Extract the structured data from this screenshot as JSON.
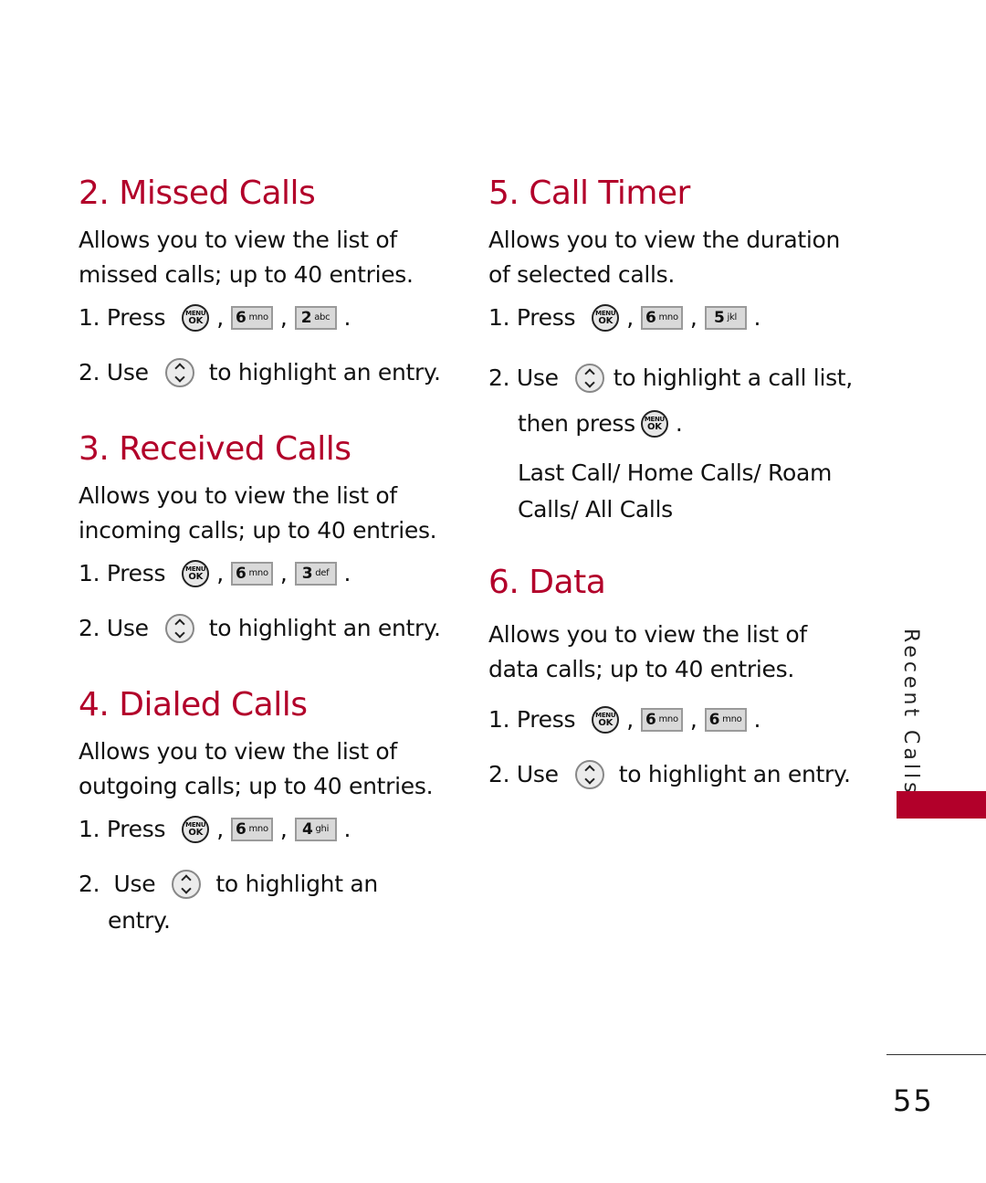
{
  "sections": {
    "missed": {
      "title": "2. Missed Calls",
      "desc_line1": "Allows you to view the list of",
      "desc_line2": "missed calls; up to 40 entries.",
      "step1_num": "1. Press",
      "step1_keys": [
        {
          "digit": "6",
          "letters": "mno"
        },
        {
          "digit": "2",
          "letters": "abc"
        }
      ],
      "step2_num": "2. Use",
      "step2_text": "to highlight an entry."
    },
    "received": {
      "title": "3. Received Calls",
      "desc_line1": "Allows you to view the list of",
      "desc_line2": "incoming calls; up to 40 entries.",
      "step1_num": "1. Press",
      "step1_keys": [
        {
          "digit": "6",
          "letters": "mno"
        },
        {
          "digit": "3",
          "letters": "def"
        }
      ],
      "step2_num": "2. Use",
      "step2_text": "to highlight an entry."
    },
    "dialed": {
      "title": "4. Dialed Calls",
      "desc_line1": "Allows you to view the list of",
      "desc_line2": "outgoing calls; up to 40 entries.",
      "step1_num": "1. Press",
      "step1_keys": [
        {
          "digit": "6",
          "letters": "mno"
        },
        {
          "digit": "4",
          "letters": "ghi"
        }
      ],
      "step2_num": "2.  Use",
      "step2_text": "to highlight an",
      "step2_cont": "entry."
    },
    "timer": {
      "title": "5. Call Timer",
      "desc_line1": "Allows you to view the duration",
      "desc_line2": "of selected calls.",
      "step1_num": "1. Press",
      "step1_keys": [
        {
          "digit": "6",
          "letters": "mno"
        },
        {
          "digit": "5",
          "letters": "jkl"
        }
      ],
      "step2_num": "2. Use",
      "step2_text": "to highlight a call list,",
      "step2_cont": "then press",
      "submenu_line1": "Last Call/ Home Calls/ Roam",
      "submenu_line2": "Calls/ All Calls"
    },
    "data": {
      "title": "6. Data",
      "desc_line1": "Allows you to view the list of",
      "desc_line2": "data calls; up to 40 entries.",
      "step1_num": "1. Press",
      "step1_keys": [
        {
          "digit": "6",
          "letters": "mno"
        },
        {
          "digit": "6",
          "letters": "mno"
        }
      ],
      "step2_num": "2. Use",
      "step2_text": "to highlight an entry."
    }
  },
  "icons": {
    "menu_top": "MENU",
    "menu_bottom": "OK",
    "comma": ",",
    "period": "."
  },
  "sidebar": {
    "label": "Recent Calls",
    "accent_color": "#b2002a"
  },
  "footer": {
    "page_number": "55"
  }
}
